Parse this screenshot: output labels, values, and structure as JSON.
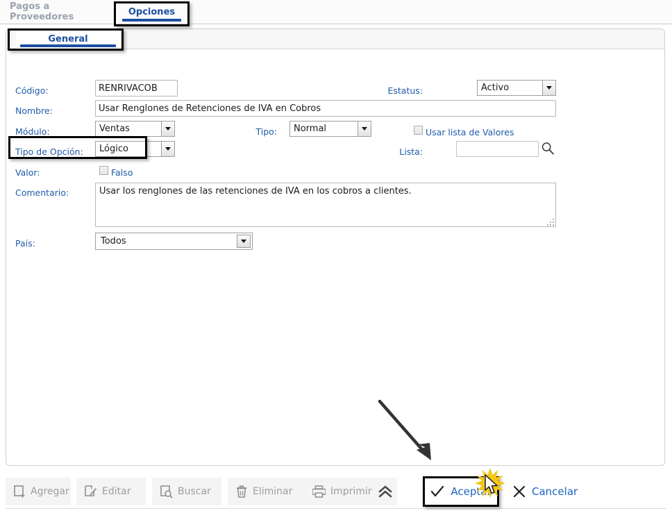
{
  "window": {
    "tabs": [
      {
        "label": "Pagos a Proveedores",
        "active": false
      },
      {
        "label": "Opciones",
        "active": true
      }
    ]
  },
  "panel": {
    "tab_label": "General"
  },
  "form": {
    "codigo": {
      "label": "Código:",
      "value": "RENRIVACOB"
    },
    "estatus": {
      "label": "Estatus:",
      "value": "Activo"
    },
    "nombre": {
      "label": "Nombre:",
      "value": "Usar Renglones de Retenciones de IVA en Cobros"
    },
    "modulo": {
      "label": "Módulo:",
      "value": "Ventas"
    },
    "tipo": {
      "label": "Tipo:",
      "value": "Normal"
    },
    "usar_lista": {
      "label": "Usar lista de Valores",
      "checked": false
    },
    "tipo_opcion": {
      "label": "Tipo de Opción:",
      "value": "Lógico"
    },
    "lista": {
      "label": "Lista:",
      "value": ""
    },
    "valor": {
      "label": "Valor:",
      "checkbox_label": "Falso",
      "checked": false
    },
    "comentario": {
      "label": "Comentario:",
      "value": "Usar los renglones de las retenciones de IVA en los cobros a clientes."
    },
    "pais": {
      "label": "País:",
      "value": "Todos"
    }
  },
  "toolbar": {
    "buttons": [
      {
        "label": "Agregar",
        "icon": "add-document-icon",
        "enabled": false
      },
      {
        "label": "Editar",
        "icon": "edit-document-icon",
        "enabled": false
      },
      {
        "label": "Buscar",
        "icon": "search-document-icon",
        "enabled": false
      },
      {
        "label": "Eliminar",
        "icon": "trash-icon",
        "enabled": false
      },
      {
        "label": "Imprimir",
        "icon": "printer-icon",
        "enabled": false
      }
    ],
    "collapse_icon": "chevron-double-up-icon",
    "accept": {
      "label": "Aceptar",
      "icon": "check-icon"
    },
    "cancel": {
      "label": "Cancelar",
      "icon": "x-icon"
    }
  },
  "annotations": {
    "highlight_boxes": [
      "opciones-tab",
      "general-tab",
      "valor-field",
      "aceptar-button"
    ],
    "arrow": "points-to-aceptar-button",
    "cursor": "arrow-cursor-with-click-burst"
  },
  "colors": {
    "label_blue": "#1e5aa8",
    "tab_active_blue": "#1c4fa1",
    "link_blue": "#1c63c4",
    "disabled_gray": "#9d9d9d",
    "annotation_black": "#000000",
    "burst_yellow": "#f5c518"
  }
}
